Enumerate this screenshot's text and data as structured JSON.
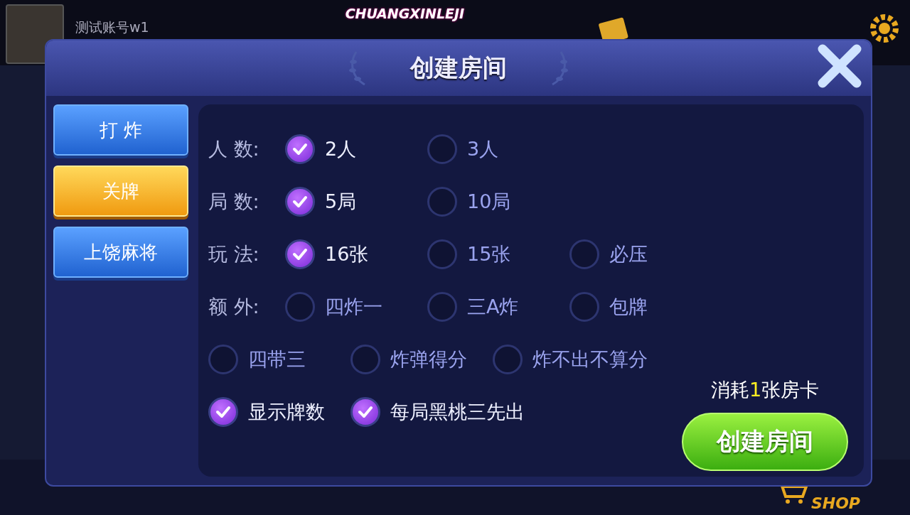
{
  "top_bar": {
    "username": "测试账号w1",
    "logo_text": "CHUANGXINLEJI"
  },
  "dialog": {
    "title": "创建房间",
    "tabs": [
      {
        "label": "打 炸",
        "selected": false
      },
      {
        "label": "关牌",
        "selected": true
      },
      {
        "label": "上饶麻将",
        "selected": false
      }
    ],
    "rows": [
      {
        "label": "人 数:",
        "options": [
          {
            "label": "2人",
            "checked": true
          },
          {
            "label": "3人",
            "checked": false
          }
        ]
      },
      {
        "label": "局 数:",
        "options": [
          {
            "label": "5局",
            "checked": true
          },
          {
            "label": "10局",
            "checked": false
          }
        ]
      },
      {
        "label": "玩 法:",
        "options": [
          {
            "label": "16张",
            "checked": true
          },
          {
            "label": "15张",
            "checked": false
          },
          {
            "label": "必压",
            "checked": false
          }
        ]
      },
      {
        "label": "额 外:",
        "options": [
          {
            "label": "四炸一",
            "checked": false
          },
          {
            "label": "三A炸",
            "checked": false
          },
          {
            "label": "包牌",
            "checked": false
          }
        ]
      },
      {
        "options": [
          {
            "label": "四带三",
            "checked": false
          },
          {
            "label": "炸弹得分",
            "checked": false
          },
          {
            "label": "炸不出不算分",
            "checked": false
          }
        ]
      },
      {
        "options": [
          {
            "label": "显示牌数",
            "checked": true
          },
          {
            "label": "每局黑桃三先出",
            "checked": true
          }
        ]
      }
    ],
    "cost": {
      "prefix": "消耗",
      "count": "1",
      "suffix": "张房卡"
    },
    "create_button": "创建房间"
  },
  "bottom_bar": {
    "shop_label": "SHOP"
  }
}
